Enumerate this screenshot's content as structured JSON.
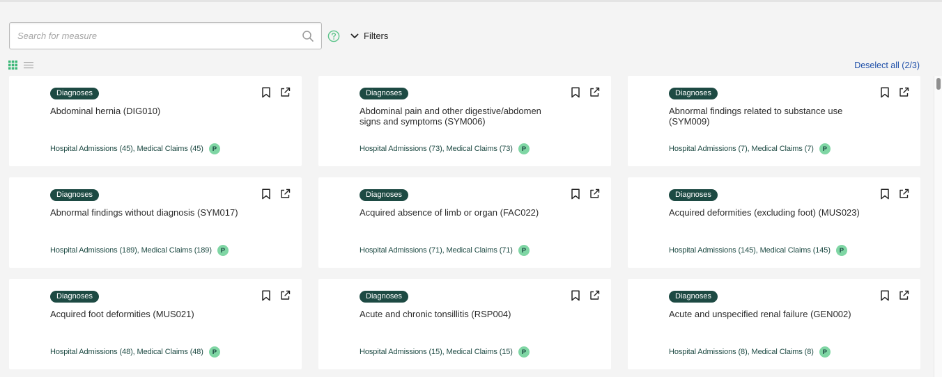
{
  "search": {
    "placeholder": "Search for measure",
    "value": ""
  },
  "toolbar": {
    "filters_label": "Filters"
  },
  "selection": {
    "deselect_label": "Deselect all (2/3)"
  },
  "icons": {
    "search": "search-icon",
    "help": "help-circle-icon",
    "filters": "chevron-down-icon",
    "grid_view": "grid-view-icon",
    "list_view": "list-view-icon",
    "bookmark": "bookmark-icon",
    "open": "external-link-icon"
  },
  "colors": {
    "badge_bg": "#1d4a43",
    "p_badge_bg": "#7fd6a4",
    "help_icon": "#5cc48a",
    "link": "#1e4fa8"
  },
  "cards": [
    {
      "category": "Diagnoses",
      "title": "Abdominal hernia (DIG010)",
      "sources": "Hospital Admissions (45), Medical Claims (45)",
      "badge": "P"
    },
    {
      "category": "Diagnoses",
      "title": "Abdominal pain and other digestive/abdomen signs and symptoms (SYM006)",
      "sources": "Hospital Admissions (73), Medical Claims (73)",
      "badge": "P"
    },
    {
      "category": "Diagnoses",
      "title": "Abnormal findings related to substance use (SYM009)",
      "sources": "Hospital Admissions (7), Medical Claims (7)",
      "badge": "P"
    },
    {
      "category": "Diagnoses",
      "title": "Abnormal findings without diagnosis (SYM017)",
      "sources": "Hospital Admissions (189), Medical Claims (189)",
      "badge": "P"
    },
    {
      "category": "Diagnoses",
      "title": "Acquired absence of limb or organ (FAC022)",
      "sources": "Hospital Admissions (71), Medical Claims (71)",
      "badge": "P"
    },
    {
      "category": "Diagnoses",
      "title": "Acquired deformities (excluding foot) (MUS023)",
      "sources": "Hospital Admissions (145), Medical Claims (145)",
      "badge": "P"
    },
    {
      "category": "Diagnoses",
      "title": "Acquired foot deformities (MUS021)",
      "sources": "Hospital Admissions (48), Medical Claims (48)",
      "badge": "P"
    },
    {
      "category": "Diagnoses",
      "title": "Acute and chronic tonsillitis (RSP004)",
      "sources": "Hospital Admissions (15), Medical Claims (15)",
      "badge": "P"
    },
    {
      "category": "Diagnoses",
      "title": "Acute and unspecified renal failure (GEN002)",
      "sources": "Hospital Admissions (8), Medical Claims (8)",
      "badge": "P"
    }
  ]
}
